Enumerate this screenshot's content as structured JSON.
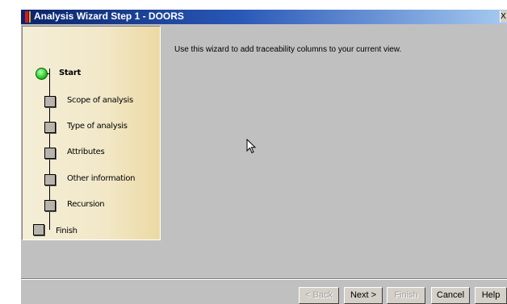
{
  "window": {
    "title": "Analysis Wizard  Step 1 - DOORS",
    "close_glyph": "X"
  },
  "steps": {
    "start": "Start",
    "items": [
      "Scope of analysis",
      "Type of analysis",
      "Attributes",
      "Other information",
      "Recursion"
    ],
    "finish": "Finish"
  },
  "content": {
    "intro": "Use this wizard to add traceability columns to your current view."
  },
  "buttons": {
    "back": "< Back",
    "next": "Next >",
    "finish": "Finish",
    "cancel": "Cancel",
    "help": "Help"
  },
  "colors": {
    "titlebar": "#0a246a",
    "face": "#c0c0c0",
    "panel": "#f2e8c8",
    "start_dot": "#22cc22"
  }
}
